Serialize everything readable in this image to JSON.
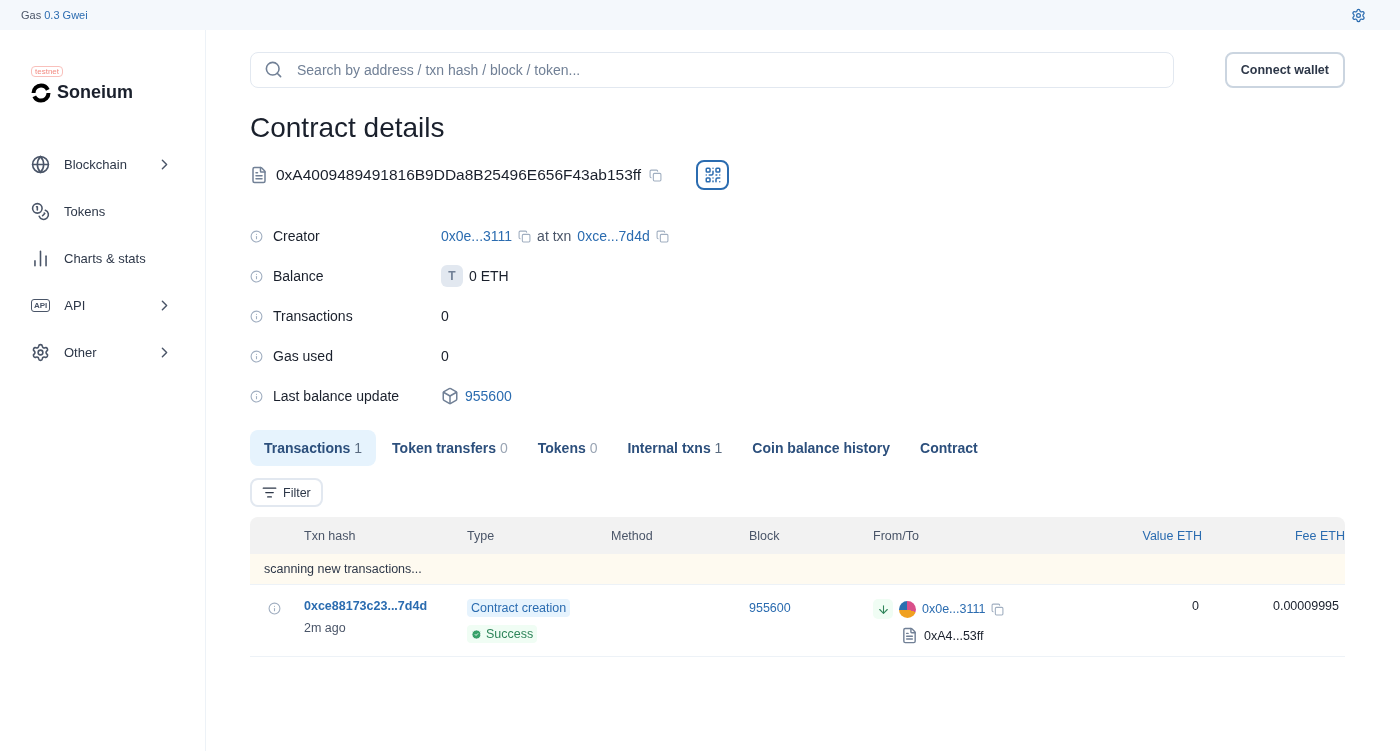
{
  "top_bar": {
    "gas_label": "Gas",
    "gas_value": "0.3 Gwei"
  },
  "sidebar": {
    "badge": "testnet",
    "logo": "Soneium",
    "items": [
      {
        "label": "Blockchain",
        "has_children": true
      },
      {
        "label": "Tokens",
        "has_children": false
      },
      {
        "label": "Charts & stats",
        "has_children": false
      },
      {
        "label": "API",
        "icon_text": "API",
        "has_children": true
      },
      {
        "label": "Other",
        "has_children": true
      }
    ]
  },
  "search": {
    "placeholder": "Search by address / txn hash / block / token..."
  },
  "connect_button": "Connect wallet",
  "title": "Contract details",
  "address": "0xA4009489491816B9DDa8B25496E656F43ab153ff",
  "details": [
    {
      "kind": "creator",
      "label": "Creator",
      "value": "0x0e...3111",
      "middle": "at txn",
      "link": "0xce...7d4d"
    },
    {
      "kind": "balance",
      "label": "Balance",
      "token": "T",
      "value": "0 ETH"
    },
    {
      "kind": "plain",
      "label": "Transactions",
      "value": "0"
    },
    {
      "kind": "plain",
      "label": "Gas used",
      "value": "0"
    },
    {
      "kind": "block",
      "label": "Last balance update",
      "value": "955600"
    }
  ],
  "tabs": [
    {
      "label": "Transactions",
      "count": "1",
      "count_muted": false,
      "selected": true
    },
    {
      "label": "Token transfers",
      "count": "0",
      "count_muted": true,
      "selected": false
    },
    {
      "label": "Tokens",
      "count": "0",
      "count_muted": true,
      "selected": false
    },
    {
      "label": "Internal txns",
      "count": "1",
      "count_muted": false,
      "selected": false
    },
    {
      "label": "Coin balance history",
      "selected": false
    },
    {
      "label": "Contract",
      "selected": false
    }
  ],
  "filter_button": "Filter",
  "table": {
    "columns": [
      {
        "label": "Txn hash",
        "kind": "plain"
      },
      {
        "label": "Type",
        "kind": "plain"
      },
      {
        "label": "Method",
        "kind": "plain"
      },
      {
        "label": "Block",
        "kind": "plain"
      },
      {
        "label": "From/To",
        "kind": "plain"
      },
      {
        "label": "Value ETH",
        "kind": "link"
      },
      {
        "label": "Fee ETH",
        "kind": "link"
      }
    ],
    "notice": "scanning new transactions...",
    "rows": [
      {
        "hash": "0xce88173c23...7d4d",
        "age": "2m ago",
        "type": "Contract creation",
        "status": "Success",
        "block": "955600",
        "from": "0x0e...3111",
        "to": "0xA4...53ff",
        "value": "0",
        "fee": "0.00009995"
      }
    ]
  }
}
